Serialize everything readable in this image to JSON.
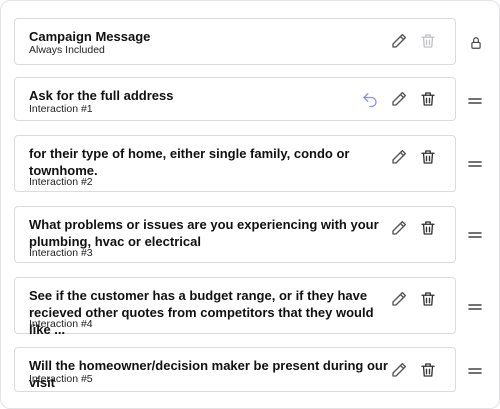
{
  "rows": [
    {
      "title": "Campaign Message",
      "subtitle": "Always Included"
    },
    {
      "title": "Ask for the full address",
      "subtitle": "Interaction #1"
    },
    {
      "title": "for their type of home, either single family, condo or townhome.",
      "subtitle": "Interaction #2"
    },
    {
      "title": "What problems or issues are you experiencing with your plumbing, hvac or electrical",
      "subtitle": "Interaction #3"
    },
    {
      "title": "See if the customer has a budget range, or if they have recieved other quotes from competitors that they would like ...",
      "subtitle": "Interaction #4"
    },
    {
      "title": "Will the homeowner/decision maker be present during our visit",
      "subtitle": "Interaction #5"
    }
  ],
  "icons": {
    "edit": "pencil-icon",
    "delete": "trash-icon",
    "undo": "undo-icon",
    "lock": "lock-icon",
    "drag": "drag-handle-icon"
  },
  "colors": {
    "text": "#111111",
    "border": "#dcdce0",
    "icon": "#555555",
    "icon_disabled": "#c4c4c8",
    "undo": "#8d8ff0"
  }
}
